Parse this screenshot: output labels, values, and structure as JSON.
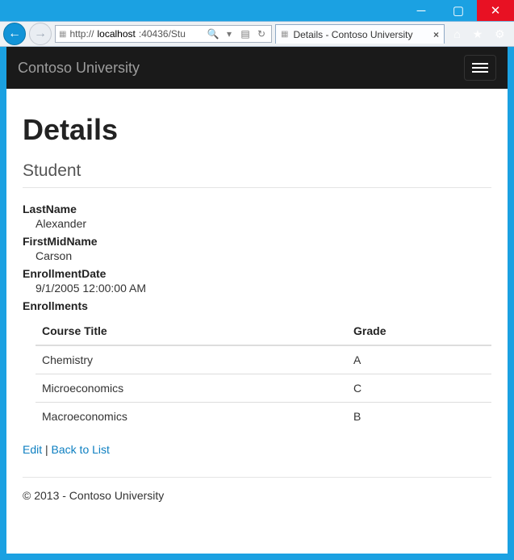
{
  "browser": {
    "url_pre": "http://",
    "url_host": "localhost",
    "url_rest": ":40436/Stu",
    "tab_title": "Details - Contoso University"
  },
  "nav": {
    "brand": "Contoso University"
  },
  "page": {
    "title": "Details",
    "subtitle": "Student"
  },
  "fields": {
    "lastname_label": "LastName",
    "lastname_value": "Alexander",
    "firstmid_label": "FirstMidName",
    "firstmid_value": "Carson",
    "enroll_label": "EnrollmentDate",
    "enroll_value": "9/1/2005 12:00:00 AM",
    "enrollments_label": "Enrollments"
  },
  "table": {
    "col1": "Course Title",
    "col2": "Grade",
    "rows": [
      {
        "title": "Chemistry",
        "grade": "A"
      },
      {
        "title": "Microeconomics",
        "grade": "C"
      },
      {
        "title": "Macroeconomics",
        "grade": "B"
      }
    ]
  },
  "links": {
    "edit": "Edit",
    "back": "Back to List"
  },
  "footer": "© 2013 - Contoso University"
}
